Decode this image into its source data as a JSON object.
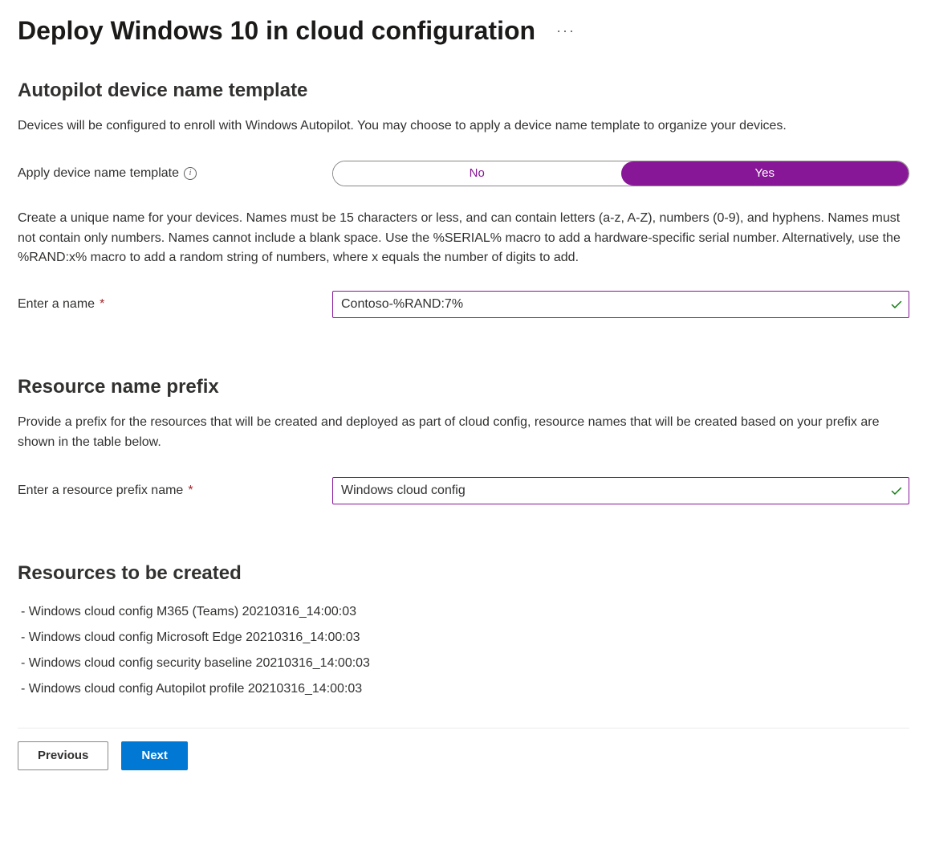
{
  "page": {
    "title": "Deploy Windows 10 in cloud configuration"
  },
  "autopilot": {
    "heading": "Autopilot device name template",
    "description": "Devices will be configured to enroll with Windows Autopilot. You may choose to apply a device name template to organize your devices.",
    "toggle_label": "Apply device name template",
    "toggle_options": {
      "no": "No",
      "yes": "Yes"
    },
    "name_help": "Create a unique name for your devices. Names must be 15 characters or less, and can contain letters (a-z, A-Z), numbers (0-9), and hyphens. Names must not contain only numbers. Names cannot include a blank space. Use the %SERIAL% macro to add a hardware-specific serial number. Alternatively, use the %RAND:x% macro to add a random string of numbers, where x equals the number of digits to add.",
    "name_label": "Enter a name",
    "name_value": "Contoso-%RAND:7%"
  },
  "prefix": {
    "heading": "Resource name prefix",
    "description": "Provide a prefix for the resources that will be created and deployed as part of cloud config, resource names that will be created based on your prefix are shown in the table below.",
    "label": "Enter a resource prefix name",
    "value": "Windows cloud config"
  },
  "resources": {
    "heading": "Resources to be created",
    "items": [
      "Windows cloud config M365 (Teams) 20210316_14:00:03",
      "Windows cloud config Microsoft Edge 20210316_14:00:03",
      "Windows cloud config security baseline 20210316_14:00:03",
      "Windows cloud config Autopilot profile 20210316_14:00:03"
    ]
  },
  "footer": {
    "previous": "Previous",
    "next": "Next"
  }
}
